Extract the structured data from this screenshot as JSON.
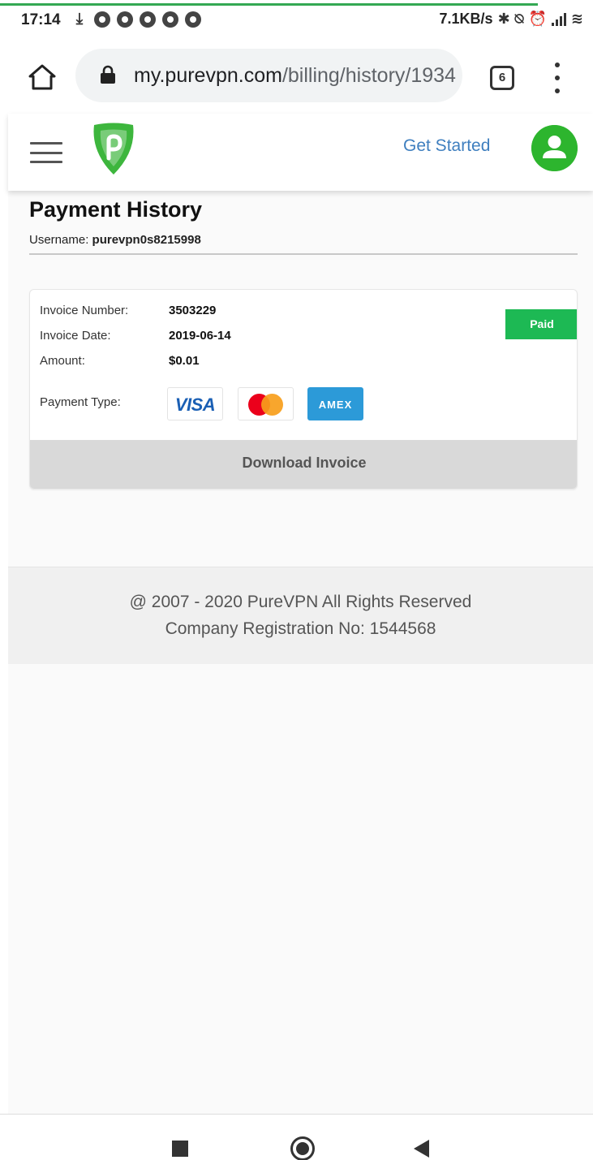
{
  "statusbar": {
    "time": "17:14",
    "download_icon": "download-icon",
    "notification_icons": [
      "chrome-icon",
      "chrome-icon",
      "chrome-icon",
      "chrome-icon",
      "chrome-icon"
    ],
    "net_speed": "7.1KB/s",
    "bluetooth_glyph": "✱",
    "mute_glyph": "⍉",
    "alarm_glyph": "⏰",
    "wifi_glyph": "≋"
  },
  "browser": {
    "url_host": "my.purevpn.com",
    "url_path": "/billing/history/1934",
    "tab_count": "6"
  },
  "site_header": {
    "cta_label": "Get Started",
    "brand_color": "#2db52e",
    "link_color": "#3f7fbf"
  },
  "page": {
    "title": "Payment History",
    "username_label": "Username: ",
    "username_value": "purevpn0s8215998"
  },
  "invoice": {
    "number_label": "Invoice Number:",
    "number_value": "3503229",
    "date_label": "Invoice Date:",
    "date_value": "2019-06-14",
    "amount_label": "Amount:",
    "amount_value": "$0.01",
    "payment_type_label": "Payment Type:",
    "status": "Paid",
    "status_color": "#1db954",
    "payment_methods": [
      "VISA",
      "Mastercard",
      "AMEX"
    ],
    "visa_text": "VISA",
    "amex_text": "AMEX",
    "download_label": "Download Invoice"
  },
  "footer": {
    "copyright": "@ 2007 - 2020 PureVPN All Rights Reserved",
    "registration": "Company Registration No: 1544568"
  }
}
